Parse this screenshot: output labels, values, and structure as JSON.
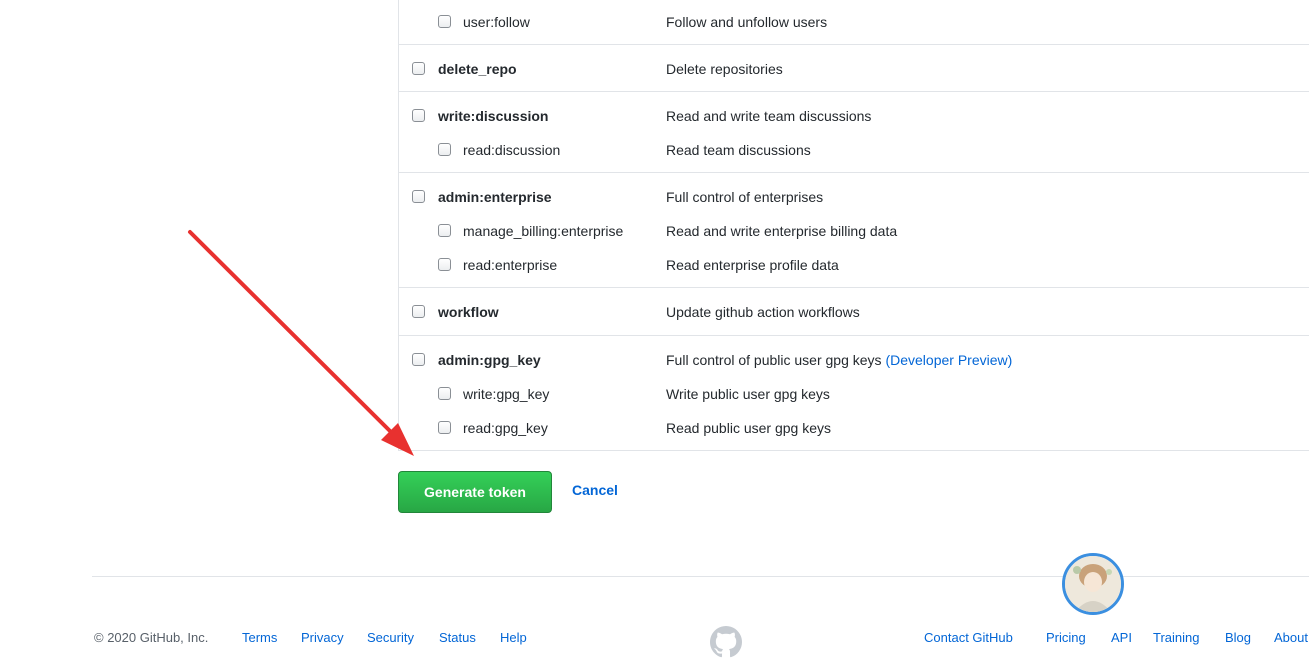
{
  "scopes": {
    "user_follow": {
      "name": "user:follow",
      "desc": "Follow and unfollow users"
    },
    "delete_repo": {
      "name": "delete_repo",
      "desc": "Delete repositories"
    },
    "write_discussion": {
      "name": "write:discussion",
      "desc": "Read and write team discussions"
    },
    "read_discussion": {
      "name": "read:discussion",
      "desc": "Read team discussions"
    },
    "admin_enterprise": {
      "name": "admin:enterprise",
      "desc": "Full control of enterprises"
    },
    "manage_billing": {
      "name": "manage_billing:enterprise",
      "desc": "Read and write enterprise billing data"
    },
    "read_enterprise": {
      "name": "read:enterprise",
      "desc": "Read enterprise profile data"
    },
    "workflow": {
      "name": "workflow",
      "desc": "Update github action workflows"
    },
    "admin_gpg": {
      "name": "admin:gpg_key",
      "desc": "Full control of public user gpg keys",
      "link": "(Developer Preview)"
    },
    "write_gpg": {
      "name": "write:gpg_key",
      "desc": "Write public user gpg keys"
    },
    "read_gpg": {
      "name": "read:gpg_key",
      "desc": "Read public user gpg keys"
    }
  },
  "actions": {
    "generate_label": "Generate token",
    "cancel_label": "Cancel"
  },
  "footer": {
    "copyright": "© 2020 GitHub, Inc.",
    "left_links": [
      "Terms",
      "Privacy",
      "Security",
      "Status",
      "Help"
    ],
    "right_links": [
      "Contact GitHub",
      "Pricing",
      "API",
      "Training",
      "Blog",
      "About"
    ]
  },
  "colors": {
    "accent_green": "#28a745",
    "link_blue": "#0366d6",
    "annotation_red": "#e8312f"
  },
  "icons": {
    "footer_logo": "github-octocat-icon",
    "annotation": "red-arrow-annotation"
  }
}
